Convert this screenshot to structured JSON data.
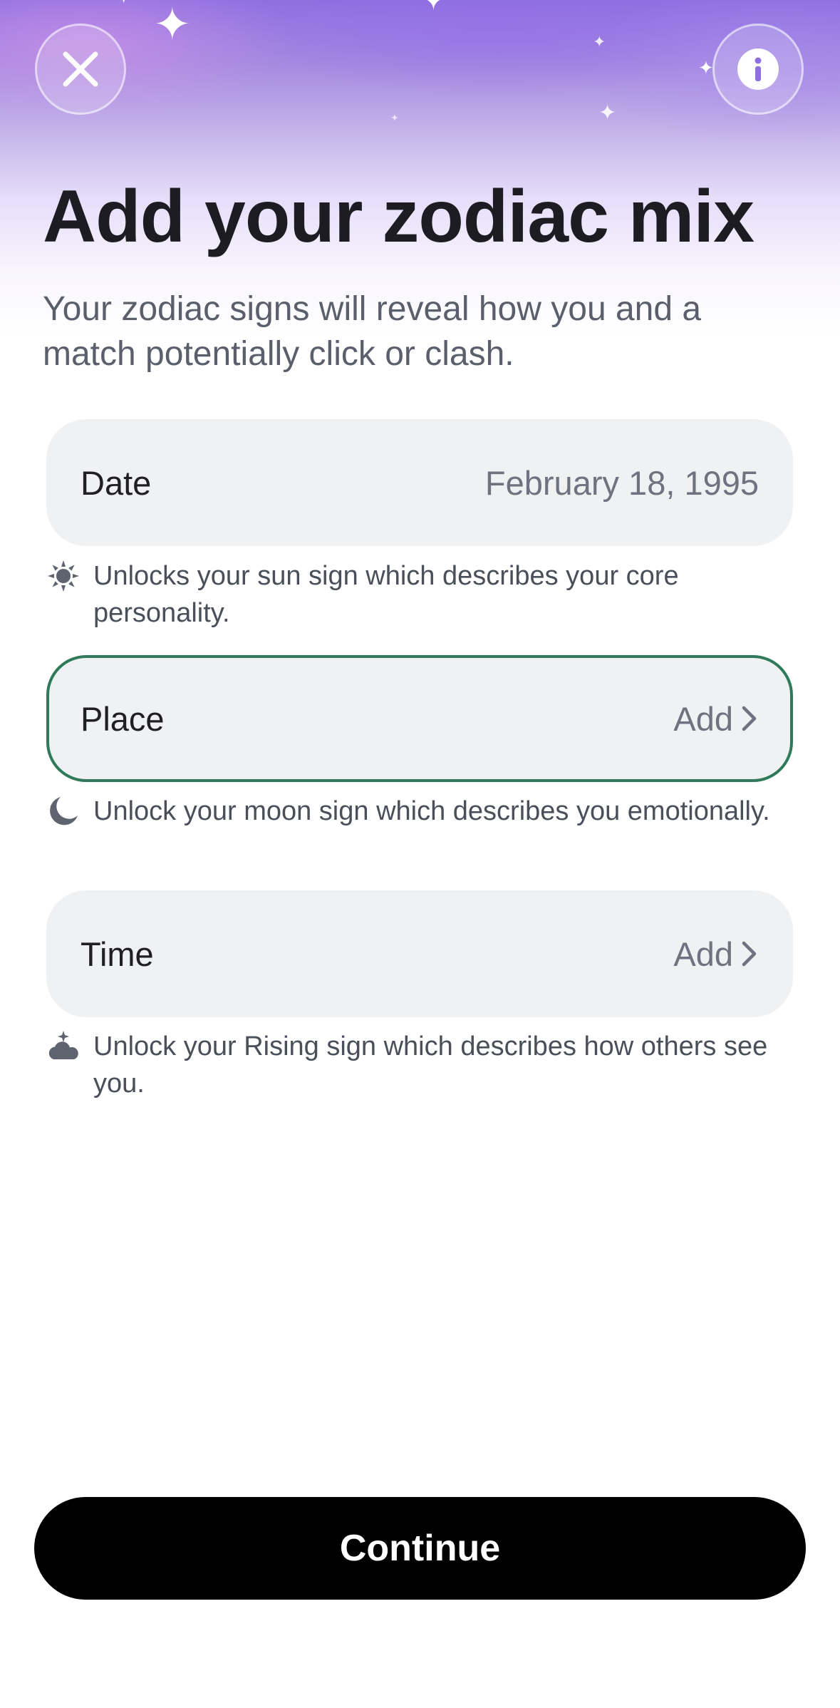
{
  "header": {
    "close_icon": "close-icon",
    "info_icon": "info-icon"
  },
  "title": "Add your zodiac mix",
  "subtitle": "Your zodiac signs will reveal how you and a match potentially click or clash.",
  "fields": {
    "date": {
      "label": "Date",
      "value": "February 18, 1995",
      "hint": "Unlocks your sun sign which describes your core personality.",
      "hint_icon": "sun-icon"
    },
    "place": {
      "label": "Place",
      "value": "Add",
      "hint": "Unlock your moon sign which describes you emotionally.",
      "hint_icon": "moon-icon",
      "focused": true
    },
    "time": {
      "label": "Time",
      "value": "Add",
      "hint": "Unlock your Rising sign which describes how others see you.",
      "hint_icon": "rising-sun-icon"
    }
  },
  "continue_label": "Continue",
  "colors": {
    "accent_border": "#2f7a5b",
    "field_bg": "#f0f1f3",
    "button_bg": "#000000",
    "hero_purple": "#8d6fe0"
  }
}
